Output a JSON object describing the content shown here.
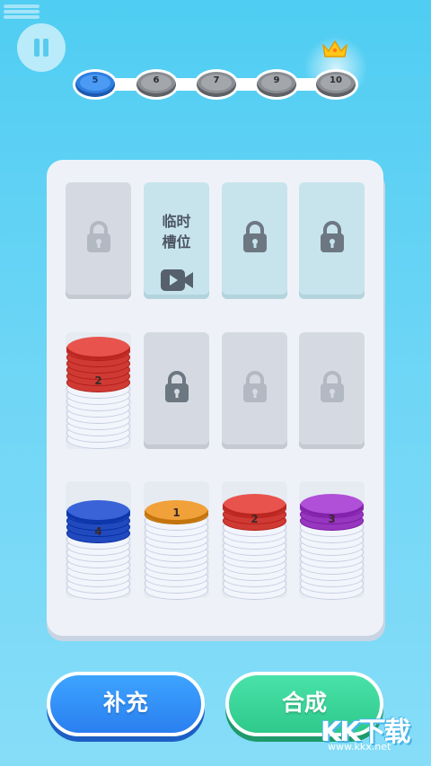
{
  "hud": {
    "pause_icon": "pause-icon",
    "levels": [
      {
        "label": "5",
        "state": "current"
      },
      {
        "label": "6",
        "state": "locked"
      },
      {
        "label": "7",
        "state": "locked"
      },
      {
        "label": "9",
        "state": "locked"
      },
      {
        "label": "10",
        "state": "goal"
      }
    ],
    "goal_icon": "crown-icon"
  },
  "board": {
    "temp_slot": {
      "label_line1": "临时",
      "label_line2": "槽位",
      "icon": "video-icon"
    },
    "stacks": [
      {
        "slot": "row2-col1",
        "top_number": "2",
        "top_color": "#e8544d",
        "colored_layers": 6,
        "white_layers": 9
      },
      {
        "slot": "row3-col1",
        "top_number": "4",
        "top_color": "#3a63d8",
        "colored_layers": 4,
        "white_layers": 9
      },
      {
        "slot": "row3-col2",
        "top_number": "1",
        "top_color": "#f0a13a",
        "colored_layers": 1,
        "white_layers": 12
      },
      {
        "slot": "row3-col3",
        "top_number": "2",
        "top_color": "#e8544d",
        "colored_layers": 3,
        "white_layers": 11
      },
      {
        "slot": "row3-col4",
        "top_number": "3",
        "top_color": "#b04fd8",
        "colored_layers": 3,
        "white_layers": 11
      }
    ]
  },
  "actions": {
    "supply_label": "补充",
    "merge_label": "合成"
  },
  "watermark": {
    "logo_text": "KK下载",
    "url": "www.kkx.net"
  }
}
